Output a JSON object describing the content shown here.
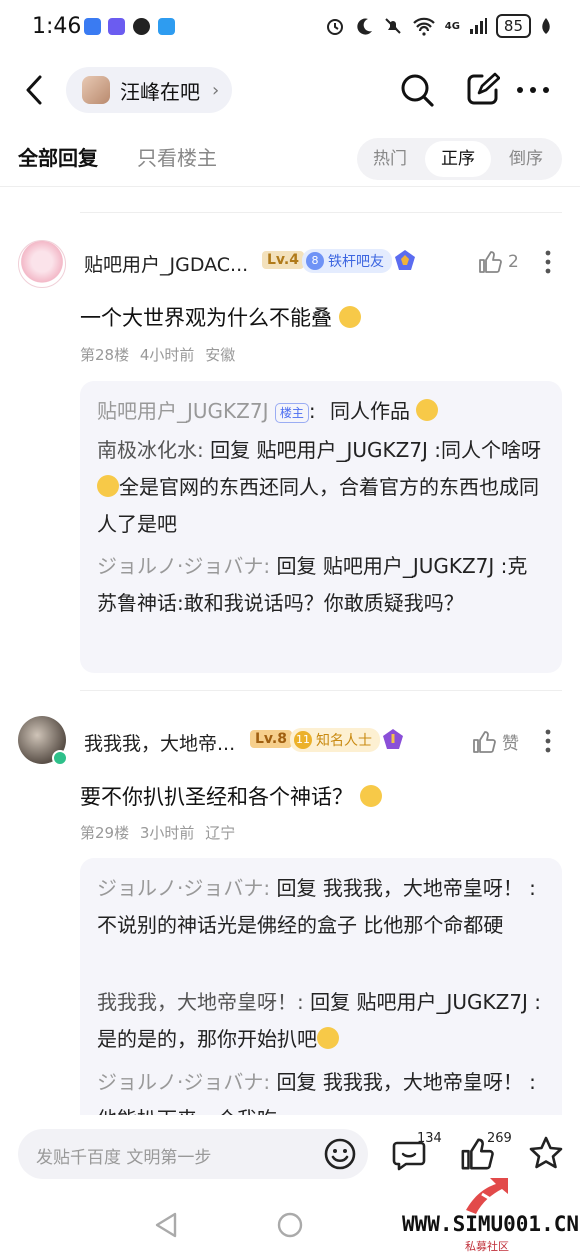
{
  "status_bar": {
    "time": "1:46",
    "network": "4G",
    "battery": "85"
  },
  "nav": {
    "forum_name": "汪峰在吧"
  },
  "tabs": {
    "all_replies": "全部回复",
    "only_op": "只看楼主",
    "sort_options": [
      "热门",
      "正序",
      "倒序"
    ],
    "sort_selected": "正序"
  },
  "posts": [
    {
      "username": "贴吧用户_JGDAC...",
      "level": "Lv.4",
      "badge_num": "8",
      "badge_text": "铁杆吧友",
      "likes": "2",
      "content": "一个大世界观为什么不能叠",
      "floor": "第28楼",
      "time_ago": "4小时前",
      "location": "安徽",
      "replies": [
        {
          "who": "贴吧用户_JUGKZ7J",
          "owner_tag": "楼主",
          "sep": ":",
          "text": "同人作品"
        },
        {
          "who": "南极冰化水:",
          "text": "回复 贴吧用户_JUGKZ7J :同人个啥呀",
          "text2": "全是官网的东西还同人，合着官方的东西也成同人了是吧"
        },
        {
          "who": "ジョルノ·ジョバナ:",
          "text": "回复 贴吧用户_JUGKZ7J :克苏鲁神话:敢和我说话吗？你敢质疑我吗？"
        }
      ]
    },
    {
      "username": "我我我，大地帝...",
      "level": "Lv.8",
      "badge_num": "11",
      "badge_text": "知名人士",
      "likes": "赞",
      "content": "要不你扒扒圣经和各个神话？",
      "floor": "第29楼",
      "time_ago": "3小时前",
      "location": "辽宁",
      "replies": [
        {
          "who": "ジョルノ·ジョバナ:",
          "text": "回复 我我我，大地帝皇呀！ :不说别的神话光是佛经的盒子 比他那个命都硬"
        },
        {
          "who": "我我我，大地帝皇呀！:",
          "text": "回复 贴吧用户_JUGKZ7J :是的是的，那你开始扒吧"
        },
        {
          "who": "ジョルノ·ジョバナ:",
          "text": "回复 我我我，大地帝皇呀！ :他能扒下来一个我吃"
        }
      ]
    }
  ],
  "bottom": {
    "input_placeholder": "发贴千百度 文明第一步",
    "comment_count": "134",
    "like_count": "269"
  },
  "watermark": {
    "site": "WWW.SIMU001.CN",
    "sub": "私募社区"
  },
  "colors": {
    "accent": "#4a6cf0",
    "lv4": "#f0d8a8",
    "lv8": "#f2c98a",
    "badge_blue": "#5b84f5",
    "badge_gold": "#e9a21c"
  }
}
